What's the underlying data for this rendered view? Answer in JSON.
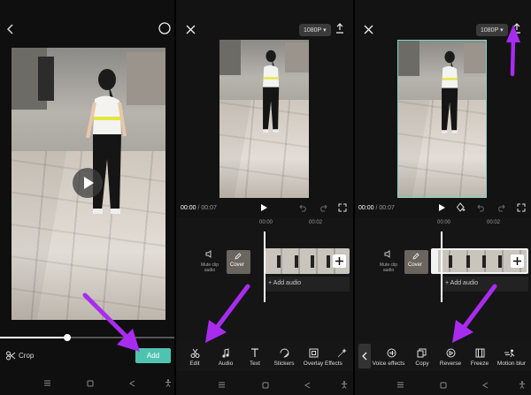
{
  "panel1": {
    "crop_label": "Crop",
    "add_label": "Add"
  },
  "panel2": {
    "resolution": "1080P",
    "time_current": "00:00",
    "time_total": "/ 00:07",
    "ruler_labels": [
      "00:00",
      "00:02"
    ],
    "mute_label": "Mute clip audio",
    "cover_label": "Cover",
    "add_audio_label": "+ Add audio",
    "tools": [
      "Edit",
      "Audio",
      "Text",
      "Stickers",
      "Overlay",
      "Effects"
    ]
  },
  "panel3": {
    "resolution": "1080P",
    "time_current": "00:00",
    "time_total": "/ 00:07",
    "ruler_labels": [
      "00:00",
      "00:02"
    ],
    "mute_label": "Mute clip audio",
    "cover_label": "Cover",
    "add_audio_label": "+ Add audio",
    "tools": [
      "Voice effects",
      "Copy",
      "Reverse",
      "Freeze",
      "Motion blur"
    ]
  },
  "colors": {
    "add_button": "#4fc3b0",
    "arrow": "#a82cf0",
    "accent_border": "#7fd9c8"
  }
}
